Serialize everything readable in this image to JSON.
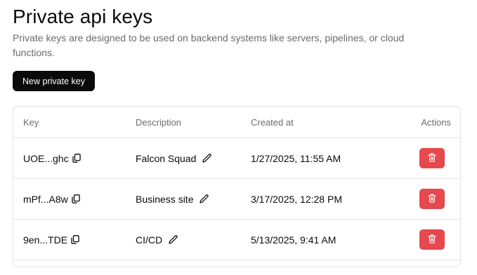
{
  "header": {
    "title": "Private api keys",
    "subtitle": "Private keys are designed to be used on backend systems like servers, pipelines, or cloud functions."
  },
  "toolbar": {
    "new_key_label": "New private key"
  },
  "table": {
    "columns": {
      "key": "Key",
      "description": "Description",
      "created_at": "Created at",
      "actions": "Actions"
    },
    "rows": [
      {
        "key": "UOE...ghc",
        "description": "Falcon Squad",
        "created_at": "1/27/2025, 11:55 AM"
      },
      {
        "key": "mPf...A8w",
        "description": "Business site",
        "created_at": "3/17/2025, 12:28 PM"
      },
      {
        "key": "9en...TDE",
        "description": "CI/CD",
        "created_at": "5/13/2025, 9:41 AM"
      }
    ]
  },
  "icons": {
    "copy": "copy-icon",
    "edit": "pencil-icon",
    "delete": "trash-icon"
  },
  "colors": {
    "primary_button": "#0a0a0a",
    "danger": "#e5484d",
    "border": "#e4e4e7",
    "muted_text": "#6b6b6b"
  }
}
